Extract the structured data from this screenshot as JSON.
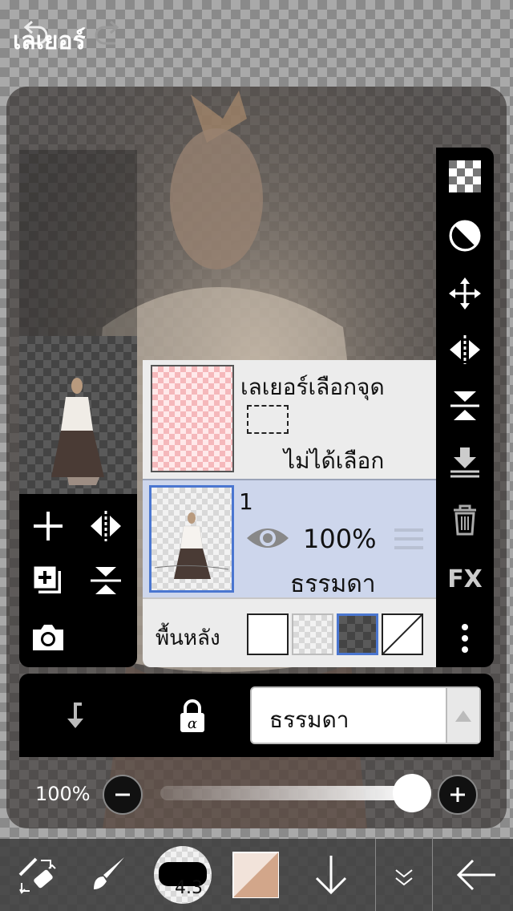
{
  "panel": {
    "title": "เลเยอร์"
  },
  "selection_layer": {
    "name": "เลเยอร์เลือกจุด",
    "status": "ไม่ได้เลือก"
  },
  "layer_1": {
    "number": "1",
    "opacity": "100%",
    "blend": "ธรรมดา"
  },
  "background": {
    "label": "พื้นหลัง",
    "options": [
      "white",
      "checker-light",
      "checker-dark",
      "none"
    ],
    "selected": "checker-dark"
  },
  "blend_mode": {
    "value": "ธรรมดา"
  },
  "opacity": {
    "label": "100%",
    "value": 1.0
  },
  "brush": {
    "size": "4.3"
  },
  "colors": {
    "accent": "#4a76d0",
    "layer_selected_bg": "#cdd6ec",
    "primary_color": "#d2a68a"
  },
  "icons": {
    "top": [
      "undo-icon",
      "redo-icon"
    ],
    "left": [
      "add-layer-icon",
      "flip-horizontal-icon",
      "duplicate-layer-icon",
      "flip-vertical-icon",
      "camera-icon"
    ],
    "right": [
      "transparency-icon",
      "opacity-circle-icon",
      "move-icon",
      "flip-horizontal-icon",
      "flip-vertical-icon",
      "merge-down-icon",
      "trash-icon",
      "fx-icon",
      "more-icon"
    ],
    "bottom": [
      "transform-icon",
      "brush-icon",
      "brush-size-icon",
      "color-icon",
      "arrow-down-icon",
      "double-chevron-icon",
      "back-icon"
    ]
  },
  "fx_label": "FX"
}
